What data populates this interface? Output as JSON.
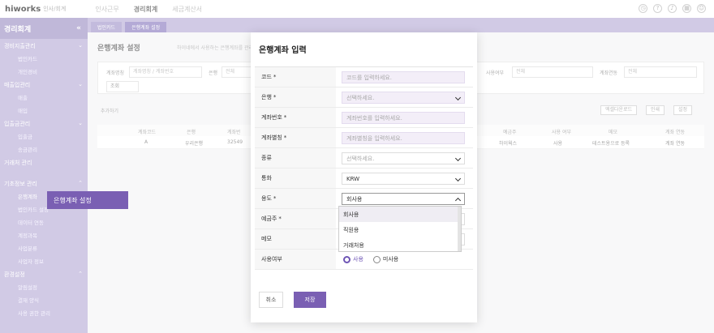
{
  "topbar": {
    "brand": "hiworks",
    "brand_sub": "인사/회계",
    "menu": [
      "인사근무",
      "경리회계",
      "세금계산서"
    ]
  },
  "sidebar": {
    "title": "경리회계",
    "sections": [
      {
        "label": "경비지출관리",
        "items": [
          "법인카드",
          "개인경비"
        ]
      },
      {
        "label": "매출입관리",
        "items": [
          "매출",
          "매입"
        ]
      },
      {
        "label": "입출금관리",
        "items": [
          "입출금",
          "송금관리"
        ]
      },
      {
        "label": "거래처 관리",
        "items": []
      },
      {
        "label": "기초정보 관리",
        "items": [
          "은행계좌",
          "법인카드 설정",
          "데이터 연동",
          "계정과목",
          "사업분류",
          "사업자 정보"
        ]
      },
      {
        "label": "환경설정",
        "items": [
          "알림설정",
          "결재 양식",
          "사용 권한 관리"
        ]
      }
    ],
    "flyout": "은행계좌 설정"
  },
  "tabs": [
    "법인카드",
    "은행계좌 설정"
  ],
  "main": {
    "title": "은행계좌 설정",
    "desc": "하이네에서 사용하는 은행계좌를 관리",
    "filter": {
      "account_label": "계좌명칭",
      "account_placeholder": "계좌명칭 / 계좌번호",
      "bank_label": "은행",
      "bank_value": "전체",
      "usage_label": "사용여부",
      "usage_value": "전체",
      "link_label": "계좌연동",
      "link_value": "전체",
      "search": "조회"
    },
    "add": "추가하기",
    "tools": [
      "엑셀다운로드",
      "인쇄",
      "설정"
    ],
    "columns": [
      "계좌코드",
      "은행",
      "계좌번",
      "예금주",
      "사용 여부",
      "메모",
      "계좌 연동"
    ],
    "row": [
      "A",
      "우리은행",
      "32549",
      "하이웍스",
      "사용",
      "테스트용으로 등록",
      "계좌 연동"
    ]
  },
  "modal": {
    "title": "은행계좌 입력",
    "fields": [
      {
        "label": "코드",
        "required": "*",
        "placeholder": "코드를 입력하세요."
      },
      {
        "label": "은행",
        "required": "*",
        "placeholder": "선택하세요."
      },
      {
        "label": "계좌번호",
        "required": "*",
        "placeholder": "계좌번호를 입력하세요."
      },
      {
        "label": "계좌별칭",
        "required": "*",
        "placeholder": "계좌별칭을 입력하세요."
      },
      {
        "label": "종류",
        "required": "",
        "placeholder": "선택하세요."
      },
      {
        "label": "통화",
        "required": "",
        "value": "KRW"
      },
      {
        "label": "용도",
        "required": "*",
        "value": "회사용"
      },
      {
        "label": "예금주",
        "required": "*",
        "value": ""
      },
      {
        "label": "메모",
        "required": "",
        "value": ""
      },
      {
        "label": "사용여부",
        "required": "",
        "value": ""
      }
    ],
    "dropdown_options": [
      "회사용",
      "직원용",
      "거래처용"
    ],
    "radio": {
      "on": "사용",
      "off": "미사용"
    },
    "cancel": "취소",
    "save": "저장"
  }
}
